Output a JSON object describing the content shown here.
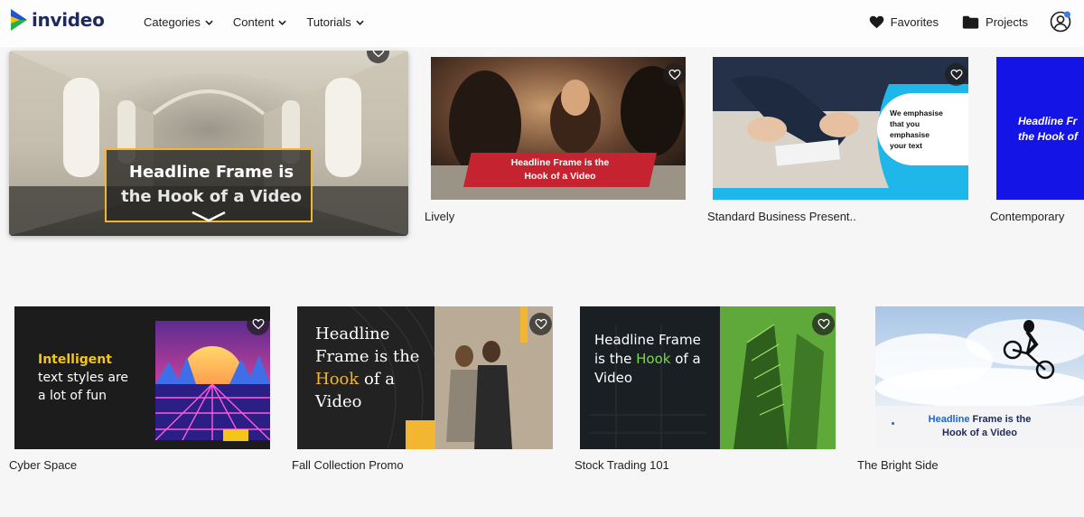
{
  "header": {
    "logo_text": "invideo",
    "nav": [
      {
        "label": "Categories"
      },
      {
        "label": "Content"
      },
      {
        "label": "Tutorials"
      }
    ],
    "favorites_label": "Favorites",
    "projects_label": "Projects"
  },
  "featured": {
    "headline_line1": "Headline Frame is",
    "headline_line2": "the Hook of a Video"
  },
  "row1": [
    {
      "label": "Lively",
      "overlay_line1": "Headline Frame is the",
      "overlay_line2": "Hook of a Video"
    },
    {
      "label": "Standard Business Present..",
      "overlay_lines": [
        "We emphasise",
        "that you",
        "emphasise",
        "your text"
      ]
    },
    {
      "label": "Contemporary",
      "overlay_line1": "Headline Fr",
      "overlay_line2": "the Hook of"
    }
  ],
  "row2": [
    {
      "label": "Cyber Space",
      "highlight": "Intelligent",
      "line2": "text styles are",
      "line3": "a lot of fun"
    },
    {
      "label": "Fall Collection Promo",
      "line1": "Headline",
      "line2": "Frame is the",
      "line3_hl": "Hook",
      "line3_rest": " of a",
      "line4": "Video"
    },
    {
      "label": "Stock Trading 101",
      "line1": "Headline Frame",
      "line2_pre": "is the ",
      "line2_hl": "Hook",
      "line2_post": " of a",
      "line3": "Video"
    },
    {
      "label": "The Bright Side",
      "line1_hl": "Headline",
      "line1_rest": " Frame is the",
      "line2": "Hook of a Video"
    }
  ],
  "colors": {
    "accent_yellow": "#f2b632",
    "cyber_yellow": "#f5c518",
    "stock_green": "#7bd94a",
    "business_cyan": "#1fb6ea",
    "contemporary_blue": "#1414e6",
    "lively_red": "#c4232f",
    "bright_blue": "#1c64d8"
  }
}
